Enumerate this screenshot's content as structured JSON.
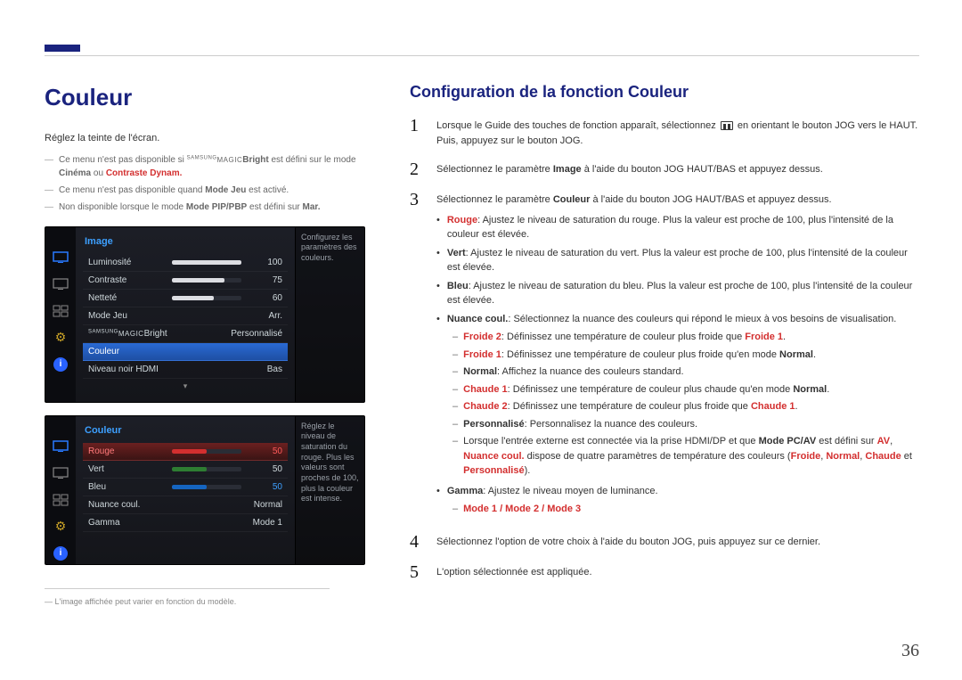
{
  "page": {
    "number": "36"
  },
  "left": {
    "title": "Couleur",
    "desc": "Réglez la teinte de l'écran.",
    "notes": {
      "n1_pre": "Ce menu n'est pas disponible si ",
      "n1_brand_sup": "SAMSUNG",
      "n1_brand": "MAGIC",
      "n1_bright": "Bright",
      "n1_mid": " est défini sur le mode ",
      "n1_cinema": "Cinéma",
      "n1_or": " ou ",
      "n1_contrast": "Contraste Dynam.",
      "n2_pre": "Ce menu n'est pas disponible quand ",
      "n2_mode": "Mode Jeu",
      "n2_post": " est activé.",
      "n3_pre": "Non disponible lorsque le mode ",
      "n3_mode": "Mode PIP/PBP",
      "n3_mid": " est défini sur ",
      "n3_mar": "Mar."
    },
    "footer_note": "L'image affichée peut varier en fonction du modèle.",
    "osd1": {
      "header": "Image",
      "help": "Configurez les paramètres des couleurs.",
      "rows": {
        "luminosite": {
          "label": "Luminosité",
          "value": "100"
        },
        "contraste": {
          "label": "Contraste",
          "value": "75"
        },
        "nettete": {
          "label": "Netteté",
          "value": "60"
        },
        "modejeu": {
          "label": "Mode Jeu",
          "value": "Arr."
        },
        "magicbright": {
          "label_brand_sup": "SAMSUNG",
          "label_brand": "MAGIC",
          "label_suffix": "Bright",
          "value": "Personnalisé"
        },
        "couleur": {
          "label": "Couleur",
          "value": ""
        },
        "hdmi": {
          "label": "Niveau noir HDMI",
          "value": "Bas"
        }
      }
    },
    "osd2": {
      "header": "Couleur",
      "help": "Réglez le niveau de saturation du rouge. Plus les valeurs sont proches de 100, plus la couleur est intense.",
      "rows": {
        "rouge": {
          "label": "Rouge",
          "value": "50"
        },
        "vert": {
          "label": "Vert",
          "value": "50"
        },
        "bleu": {
          "label": "Bleu",
          "value": "50"
        },
        "nuance": {
          "label": "Nuance coul.",
          "value": "Normal"
        },
        "gamma": {
          "label": "Gamma",
          "value": "Mode 1"
        }
      }
    }
  },
  "right": {
    "title": "Configuration de la fonction Couleur",
    "step1_a": "Lorsque le Guide des touches de fonction apparaît, sélectionnez ",
    "step1_b": " en orientant le bouton JOG vers le HAUT. Puis, appuyez sur le bouton JOG.",
    "step2_a": "Sélectionnez le paramètre ",
    "step2_img": "Image",
    "step2_b": " à l'aide du bouton JOG HAUT/BAS et appuyez dessus.",
    "step3_a": "Sélectionnez le paramètre ",
    "step3_c": "Couleur",
    "step3_b": " à l'aide du bouton JOG HAUT/BAS et appuyez dessus.",
    "bullets": {
      "rouge_l": "Rouge",
      "rouge_t": ": Ajustez le niveau de saturation du rouge. Plus la valeur est proche de 100, plus l'intensité de la couleur est élevée.",
      "vert_l": "Vert",
      "vert_t": ": Ajustez le niveau de saturation du vert. Plus la valeur est proche de 100, plus l'intensité de la couleur est élevée.",
      "bleu_l": "Bleu",
      "bleu_t": ": Ajustez le niveau de saturation du bleu. Plus la valeur est proche de 100, plus l'intensité de la couleur est élevée.",
      "nuance_l": "Nuance coul.",
      "nuance_t": ": Sélectionnez la nuance des couleurs qui répond le mieux à vos besoins de visualisation.",
      "gamma_l": "Gamma",
      "gamma_t": ": Ajustez le niveau moyen de luminance."
    },
    "sub": {
      "froide2_l": "Froide 2",
      "froide2_t": ": Définissez une température de couleur plus froide que ",
      "froide2_ref": "Froide 1",
      "froide2_end": ".",
      "froide1_l": "Froide 1",
      "froide1_t": ": Définissez une température de couleur plus froide qu'en mode ",
      "froide1_ref": "Normal",
      "froide1_end": ".",
      "normal_l": "Normal",
      "normal_t": ": Affichez la nuance des couleurs standard.",
      "chaude1_l": "Chaude 1",
      "chaude1_t": ": Définissez une température de couleur plus chaude qu'en mode ",
      "chaude1_ref": "Normal",
      "chaude1_end": ".",
      "chaude2_l": "Chaude 2",
      "chaude2_t": ": Définissez une température de couleur plus froide que ",
      "chaude2_ref": "Chaude 1",
      "chaude2_end": ".",
      "perso_l": "Personnalisé",
      "perso_t": ": Personnalisez la nuance des couleurs.",
      "extern_a": "Lorsque l'entrée externe est connectée via la prise HDMI/DP et que ",
      "extern_mode": "Mode PC/AV",
      "extern_b": " est défini sur ",
      "extern_av": "AV",
      "extern_c": ", ",
      "extern_nuance": "Nuance coul.",
      "extern_d": " dispose de quatre paramètres de température des couleurs (",
      "extern_p1": "Froide",
      "extern_s1": ", ",
      "extern_p2": "Normal",
      "extern_s2": ", ",
      "extern_p3": "Chaude",
      "extern_s3": " et ",
      "extern_p4": "Personnalisé",
      "extern_end": ").",
      "modes": "Mode 1 / Mode 2  / Mode 3"
    },
    "step4": "Sélectionnez l'option de votre choix à l'aide du bouton JOG, puis appuyez sur ce dernier.",
    "step5": "L'option sélectionnée est appliquée."
  }
}
